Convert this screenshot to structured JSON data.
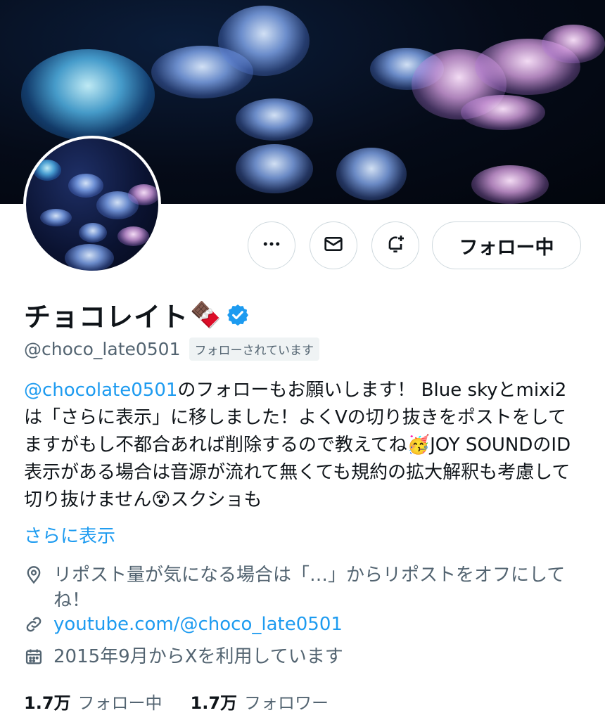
{
  "header": {
    "banner_alt": "jellyfish-banner",
    "avatar_alt": "jellyfish-avatar"
  },
  "actions": {
    "more_icon": "more-horizontal-icon",
    "message_icon": "envelope-icon",
    "notify_icon": "bell-plus-icon",
    "follow_label": "フォロー中"
  },
  "profile": {
    "display_name": "チョコレイト",
    "name_emoji": "🍫",
    "verified_icon": "verified-badge-icon",
    "handle": "@choco_late0501",
    "follows_you_badge": "フォローされています"
  },
  "bio": {
    "mention": "@chocolate0501",
    "text_1": "のフォローもお願いします！ Blue skyとmixi2は「さらに表示」に移しました！よくVの切り抜きをポストをしてますがもし不都合あれば削除するので教えてね",
    "emoji_1": "🥳",
    "text_2": "JOY SOUNDのID表示がある場合は音源が流れて無くても規約の拡大解釈も考慮して切り抜けません",
    "emoji_2": "😵",
    "text_3": "スクショも",
    "show_more": "さらに表示"
  },
  "meta": {
    "location_icon": "location-pin-icon",
    "location": "リポスト量が気になる場合は「…」からリポストをオフにしてね！",
    "link_icon": "link-icon",
    "link": "youtube.com/@choco_late0501",
    "joined_icon": "calendar-icon",
    "joined": "2015年9月からXを利用しています"
  },
  "stats": {
    "following_count": "1.7万",
    "following_label": "フォロー中",
    "followers_count": "1.7万",
    "followers_label": "フォロワー"
  },
  "colors": {
    "accent": "#1d9bf0",
    "secondary_text": "#536471",
    "border": "#cfd9de"
  }
}
